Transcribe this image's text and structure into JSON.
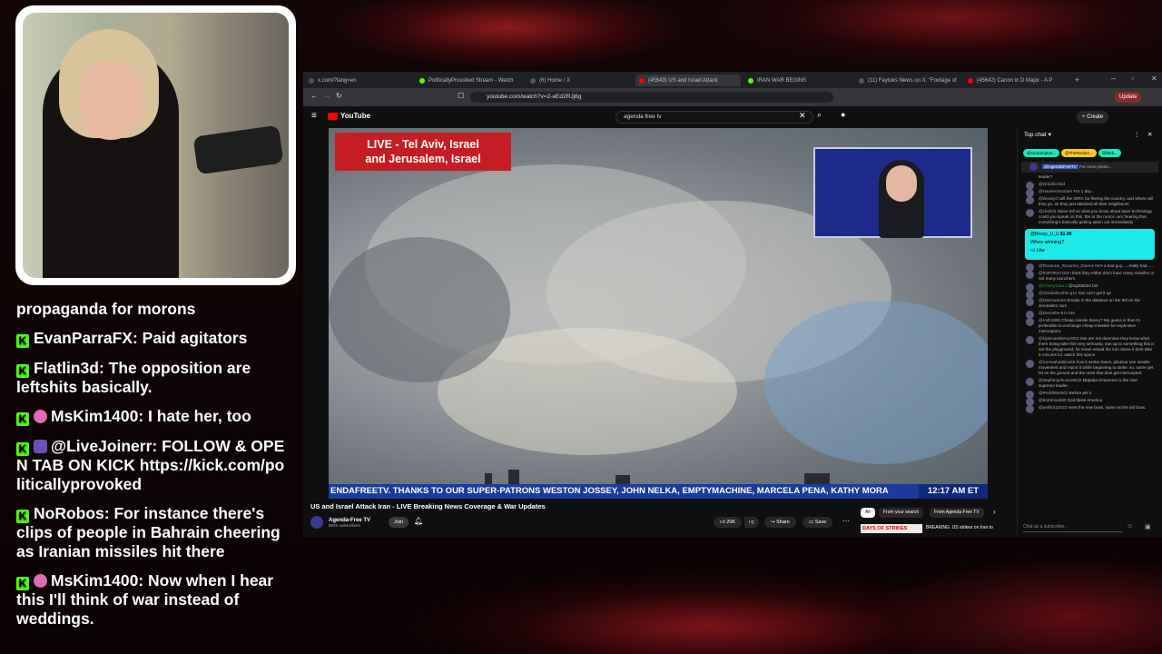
{
  "stream_chat": [
    {
      "user": "",
      "text": "propaganda for morons",
      "badge": "none"
    },
    {
      "user": "EvanParraFX",
      "text": "Paid agitators",
      "badge": "kick"
    },
    {
      "user": "Flatlin3d",
      "text": "The opposition are leftshits basically.",
      "badge": "kick"
    },
    {
      "user": "MsKim1400",
      "text": "I hate her, too",
      "badge": "kick+sub"
    },
    {
      "user": "@LiveJoinerr",
      "text": "FOLLOW & OPEN TAB ON KICK https://kick.com/politicallyprovoked",
      "badge": "kick+mod"
    },
    {
      "user": "NoRobos",
      "text": "For instance there's clips of people in Bahrain cheering as Iranian missiles hit there",
      "badge": "kick"
    },
    {
      "user": "MsKim1400",
      "text": "Now when I hear this I'll think of war instead of weddings.",
      "badge": "kick+sub"
    }
  ],
  "browser": {
    "tabs": [
      {
        "title": "x.com/?lang=en",
        "active": false
      },
      {
        "title": "PoliticallyProvoked Stream - Watch",
        "active": false
      },
      {
        "title": "(6) Home / X",
        "active": false
      },
      {
        "title": "(45643) US and Israel Attack",
        "active": true
      },
      {
        "title": "IRAN WAR BEGINS",
        "active": false
      },
      {
        "title": "(11) Faytuks News on X: \"Footage of",
        "active": false
      },
      {
        "title": "(45642) Canon in D Major - A P",
        "active": false
      }
    ],
    "url": "youtube.com/watch?v=2-eEd2RJj6g",
    "update_label": "Update"
  },
  "youtube": {
    "logo": "YouTube",
    "search_value": "agenda free tv",
    "create_label": "Create",
    "video": {
      "banner_line1": "LIVE - Tel Aviv, Israel",
      "banner_line2": "and Jerusalem, Israel",
      "ticker": "ENDAFREETV. THANKS TO OUR SUPER-PATRONS WESTON JOSSEY, JOHN NELKA, EMPTYMACHINE, MARCELA PENA, KATHY MORA",
      "ticker_time": "12:17 AM ET"
    },
    "title": "US and Israel Attack Iran - LIVE Breaking News Coverage & War Updates",
    "channel": "Agenda-Free TV",
    "subscribers": "882K subscribers",
    "join_label": "Join",
    "likes": "20K",
    "share_label": "Share",
    "save_label": "Save",
    "rec_chips": [
      "All",
      "From your search",
      "From Agenda-Free TV"
    ],
    "rec_item": "BREAKING: US strikes on Iran to",
    "rec_badge": "DAYS OF STRIKES"
  },
  "live_chat": {
    "header": "Top chat",
    "donors": [
      "@rachumpton...",
      "@TheReal2A...",
      "@thek..."
    ],
    "pinned_user": "@AgendaFreeTV",
    "pinned_text": "For more photo...",
    "super_chat": {
      "user": "@Bossy_U_U",
      "amount": "$1.99",
      "text": "Whos winning?",
      "like": "Like"
    },
    "messages": [
      {
        "name": "",
        "text": "leader?"
      },
      {
        "name": "@Grizzllo",
        "text": "bird"
      },
      {
        "name": "@HackersScouter",
        "text": "For 1 day..."
      },
      {
        "name": "@tlerakyO",
        "text": "will the IGRC be fleeing the country, and where will they go, as they just attacked all their neighbours"
      },
      {
        "name": "@cbolt33",
        "text": "Steve tell us what you know about laser technology could you speak on this. this is the rumor i am hearing that everything's basically getting taken out immediately"
      },
      {
        "name": "@Roxanne_Roxanne_Dianne",
        "text": "he's a bad guy......really bad......"
      },
      {
        "name": "@RSP3RS7103",
        "text": "I think they either don't have many missiles or not many launchers"
      },
      {
        "name": "@CherryCola.1",
        "text": "@sq355024 fair"
      },
      {
        "name": "@OtisalaBooble-g1s",
        "text": "Iran can't get it up"
      },
      {
        "name": "@kidsmusic94",
        "text": "Smoke in the distance on the left on the Jerusalem cam"
      },
      {
        "name": "@Denoshe-b7c",
        "text": "bro"
      },
      {
        "name": "@rmth1890",
        "text": "Cheap missile theory? My guess is that it's preferable to exchange cheap missiles for expensive interceptors."
      },
      {
        "name": "@kiplenasitberry3302",
        "text": "iran are not dummies they know what there doing take this very seriously. iran up to something this is not the playground, for israel reload the iron dome it dont take 5 minutes lol..watch this space"
      },
      {
        "name": "@Sorseaha99ice69",
        "text": "how it works Steve, pilot/car see missile movement and report it while beginning to strike. so, some get hit on the ground and the ones that dont get intercepted."
      },
      {
        "name": "@stephenjohnson9632",
        "text": "Mojtaba Khamenei is the new supreme leader."
      },
      {
        "name": "@RedditWorld1",
        "text": "Before pls it"
      },
      {
        "name": "@brettmax590",
        "text": "God bless America"
      },
      {
        "name": "@petlilcky2022",
        "text": "meet the new boss, same as the old boss."
      }
    ],
    "input_placeholder": "Chat as a subscriber..."
  }
}
